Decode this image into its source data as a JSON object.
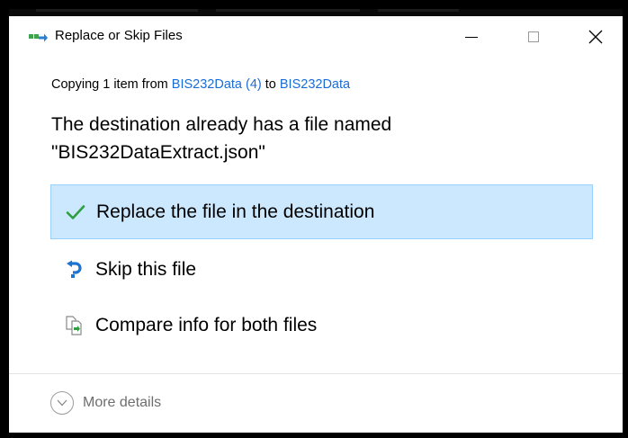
{
  "window": {
    "title": "Replace or Skip Files",
    "app_icon": "copy-files-icon",
    "controls": {
      "minimize_icon": "minimize-icon",
      "maximize_icon": "maximize-icon",
      "close_icon": "close-icon",
      "close_glyph": "✕"
    }
  },
  "copy_status": {
    "prefix": "Copying 1 item from ",
    "source": "BIS232Data (4)",
    "middle": " to ",
    "destination": "BIS232Data"
  },
  "message": {
    "line1": "The destination already has a file named",
    "line2": "\"BIS232DataExtract.json\""
  },
  "options": [
    {
      "label": "Replace the file in the destination",
      "icon": "checkmark-icon",
      "selected": true
    },
    {
      "label": "Skip this file",
      "icon": "skip-arrow-icon",
      "selected": false
    },
    {
      "label": "Compare info for both files",
      "icon": "compare-files-icon",
      "selected": false
    }
  ],
  "footer": {
    "more_details_label": "More details",
    "icon": "chevron-down-circle-icon"
  },
  "colors": {
    "link": "#1a6dd6",
    "selected_bg": "#cce8ff",
    "selected_border": "#99d1ff",
    "check_green": "#2e9e3e",
    "skip_blue": "#1f73d1",
    "muted_text": "#6d6d6d"
  }
}
